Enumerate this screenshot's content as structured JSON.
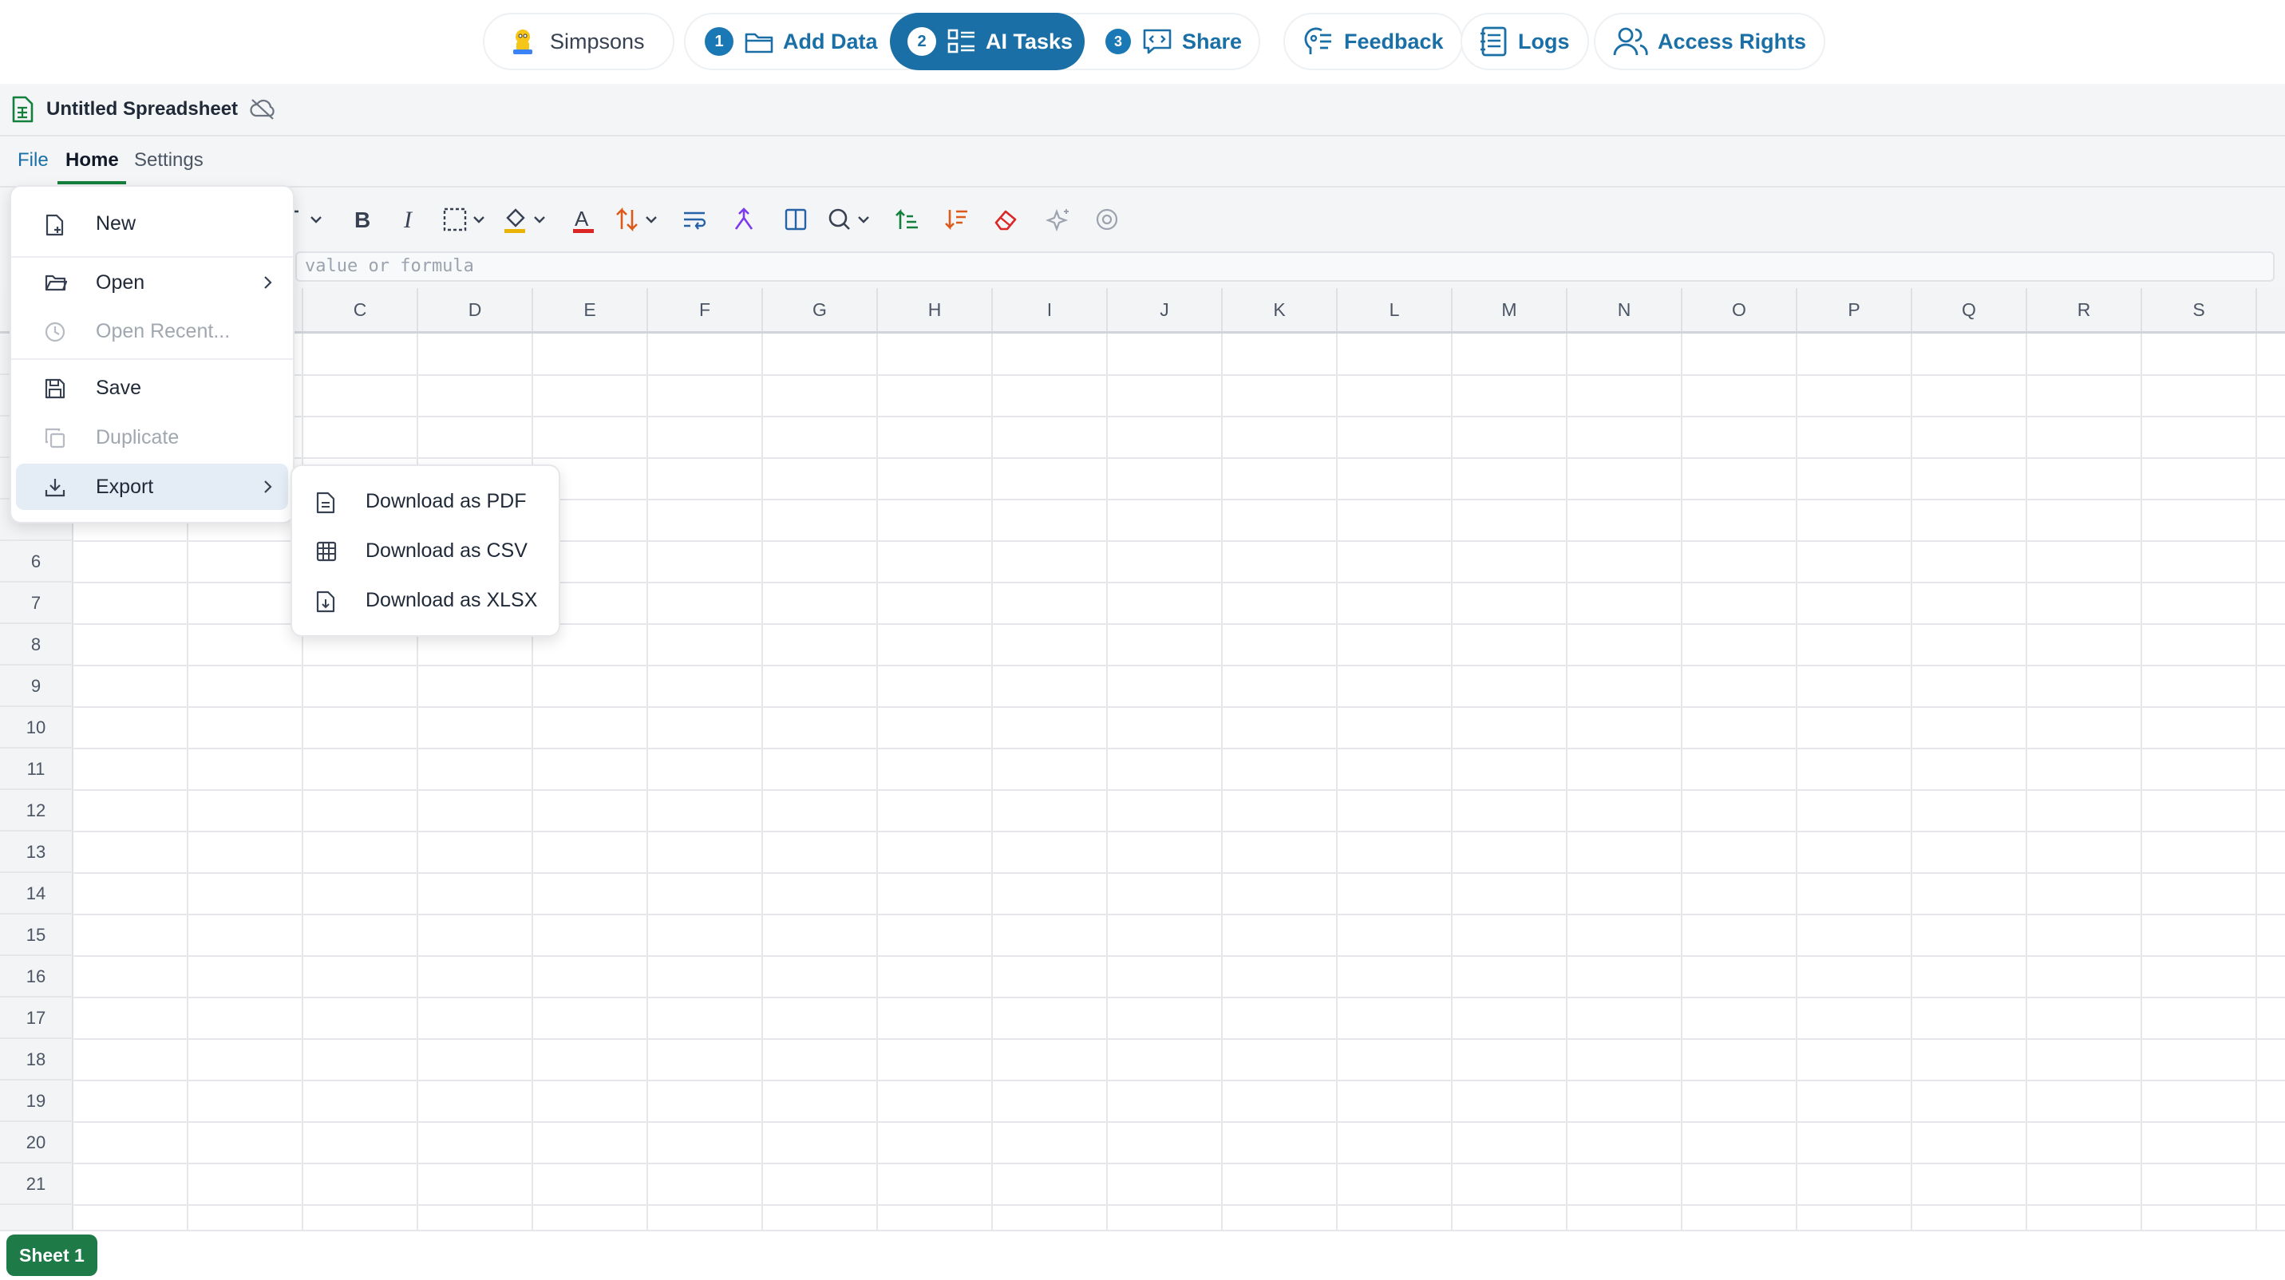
{
  "topnav": {
    "project": "Simpsons",
    "steps": [
      {
        "num": "1",
        "label": "Add Data"
      },
      {
        "num": "2",
        "label": "AI Tasks"
      },
      {
        "num": "3",
        "label": "Share"
      }
    ],
    "feedback": "Feedback",
    "logs": "Logs",
    "access_rights": "Access Rights"
  },
  "document": {
    "title": "Untitled Spreadsheet"
  },
  "menubar": {
    "file": "File",
    "home": "Home",
    "settings": "Settings"
  },
  "formula": {
    "placeholder": "value or formula"
  },
  "grid": {
    "columns": [
      "C",
      "D",
      "E",
      "F",
      "G",
      "H",
      "I",
      "J",
      "K",
      "L",
      "M",
      "N",
      "O",
      "P",
      "Q",
      "R",
      "S"
    ],
    "rows": [
      "6",
      "7",
      "8",
      "9",
      "10",
      "11",
      "12",
      "13",
      "14",
      "15",
      "16",
      "17",
      "18",
      "19",
      "20",
      "21"
    ]
  },
  "file_menu": {
    "new": "New",
    "open": "Open",
    "open_recent": "Open Recent...",
    "save": "Save",
    "duplicate": "Duplicate",
    "export": "Export"
  },
  "export_menu": {
    "pdf": "Download as PDF",
    "csv": "Download as CSV",
    "xlsx": "Download as XLSX"
  },
  "sheets": {
    "active": "Sheet 1"
  },
  "colors": {
    "accent": "#1a6fa6",
    "sheet_green": "#1e7a47",
    "home_underline": "#15803d"
  }
}
